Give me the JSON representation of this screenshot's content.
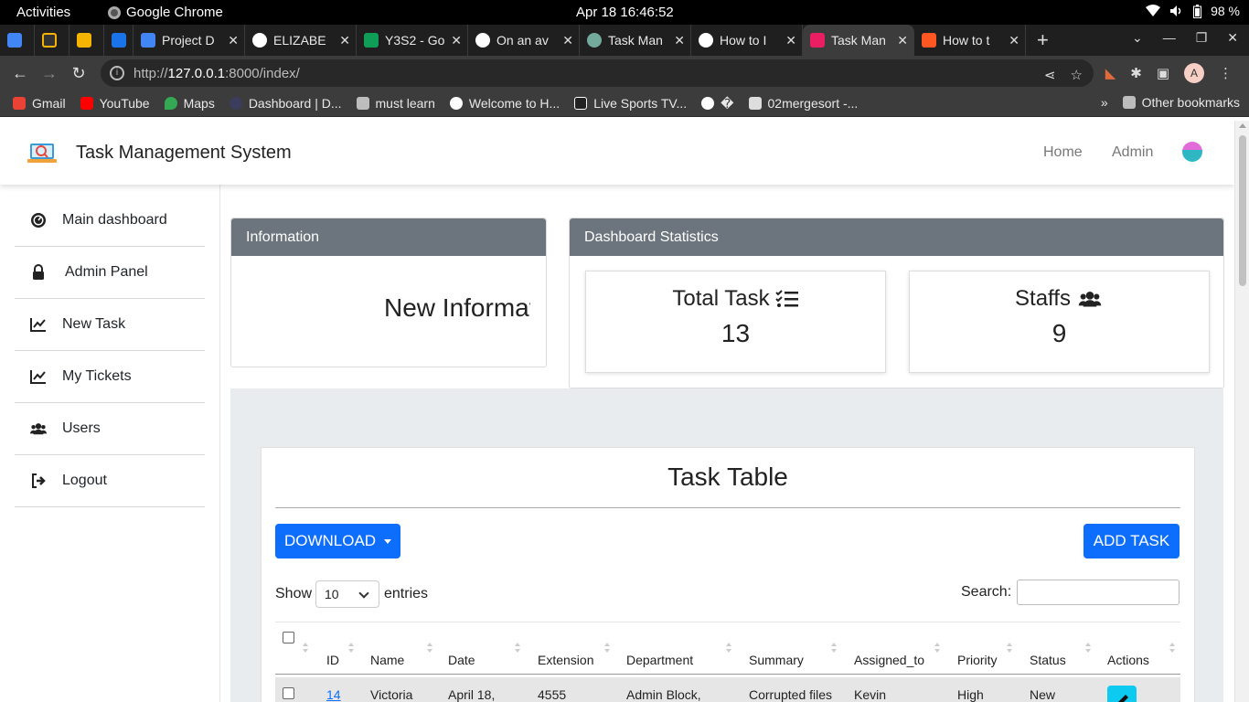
{
  "os": {
    "activities": "Activities",
    "app_name": "Google Chrome",
    "clock": "Apr 18  16:46:52",
    "battery": "98 %"
  },
  "browser": {
    "tabs": [
      {
        "label": "",
        "color": "#4285f4"
      },
      {
        "label": "",
        "color": "#333333"
      },
      {
        "label": "",
        "color": "#f4b400"
      },
      {
        "label": "",
        "color": "#1a73e8"
      },
      {
        "label": "Project D",
        "color": "#4285f4"
      },
      {
        "label": "ELIZABE",
        "color": "#ffffff"
      },
      {
        "label": "Y3S2 - Go",
        "color": "#0f9d58"
      },
      {
        "label": "On an av",
        "color": "#ffffff"
      },
      {
        "label": "Task Man",
        "color": "#74aa9c"
      },
      {
        "label": "How to I",
        "color": "#ffffff"
      },
      {
        "label": "Task Man",
        "color": "#e91e63",
        "active": true
      },
      {
        "label": "How to t",
        "color": "#ff5722"
      }
    ],
    "url_prefix": "http://",
    "url_host": "127.0.0.1",
    "url_rest": ":8000/index/",
    "profile_initial": "A",
    "bookmarks": [
      {
        "label": "Gmail",
        "color": "#ea4335"
      },
      {
        "label": "YouTube",
        "color": "#ff0000"
      },
      {
        "label": "Maps",
        "color": "#34a853"
      },
      {
        "label": "Dashboard | D...",
        "color": "#3c3c5c"
      },
      {
        "label": "must learn",
        "color": "#bdbdbd"
      },
      {
        "label": "Welcome to H...",
        "color": "#ffffff"
      },
      {
        "label": "Live Sports TV...",
        "color": "#222222"
      },
      {
        "label": "�",
        "color": "#ffffff"
      },
      {
        "label": "02mergesort -...",
        "color": "#dddddd"
      }
    ],
    "more_bookmarks": "»",
    "other_bookmarks": "Other bookmarks"
  },
  "navbar": {
    "title": "Task Management System",
    "links": [
      "Home",
      "Admin"
    ]
  },
  "sidebar": {
    "items": [
      {
        "label": "Main dashboard",
        "icon": "gauge-icon"
      },
      {
        "label": "Admin Panel",
        "icon": "lock-icon"
      },
      {
        "label": "New Task",
        "icon": "chart-line-icon"
      },
      {
        "label": "My Tickets",
        "icon": "chart-line-icon"
      },
      {
        "label": "Users",
        "icon": "users-icon"
      },
      {
        "label": "Logout",
        "icon": "sign-out-icon"
      }
    ]
  },
  "information": {
    "header": "Information",
    "text": "New Information"
  },
  "stats": {
    "header": "Dashboard Statistics",
    "total_task_label": "Total Task",
    "total_task_value": "13",
    "staffs_label": "Staffs",
    "staffs_value": "9"
  },
  "task_table": {
    "title": "Task Table",
    "download_label": "DOWNLOAD",
    "add_label": "ADD TASK",
    "show_label": "Show",
    "entries_value": "10",
    "entries_label": "entries",
    "search_label": "Search:",
    "columns": [
      "ID",
      "Name",
      "Date",
      "Extension",
      "Department",
      "Summary",
      "Assigned_to",
      "Priority",
      "Status",
      "Actions"
    ],
    "rows": [
      {
        "id": "14",
        "name": "Victoria",
        "date": "April 18,",
        "extension": "4555",
        "department": "Admin Block,",
        "summary": "Corrupted files",
        "assigned_to": "Kevin",
        "priority": "High",
        "status": "New"
      }
    ]
  }
}
